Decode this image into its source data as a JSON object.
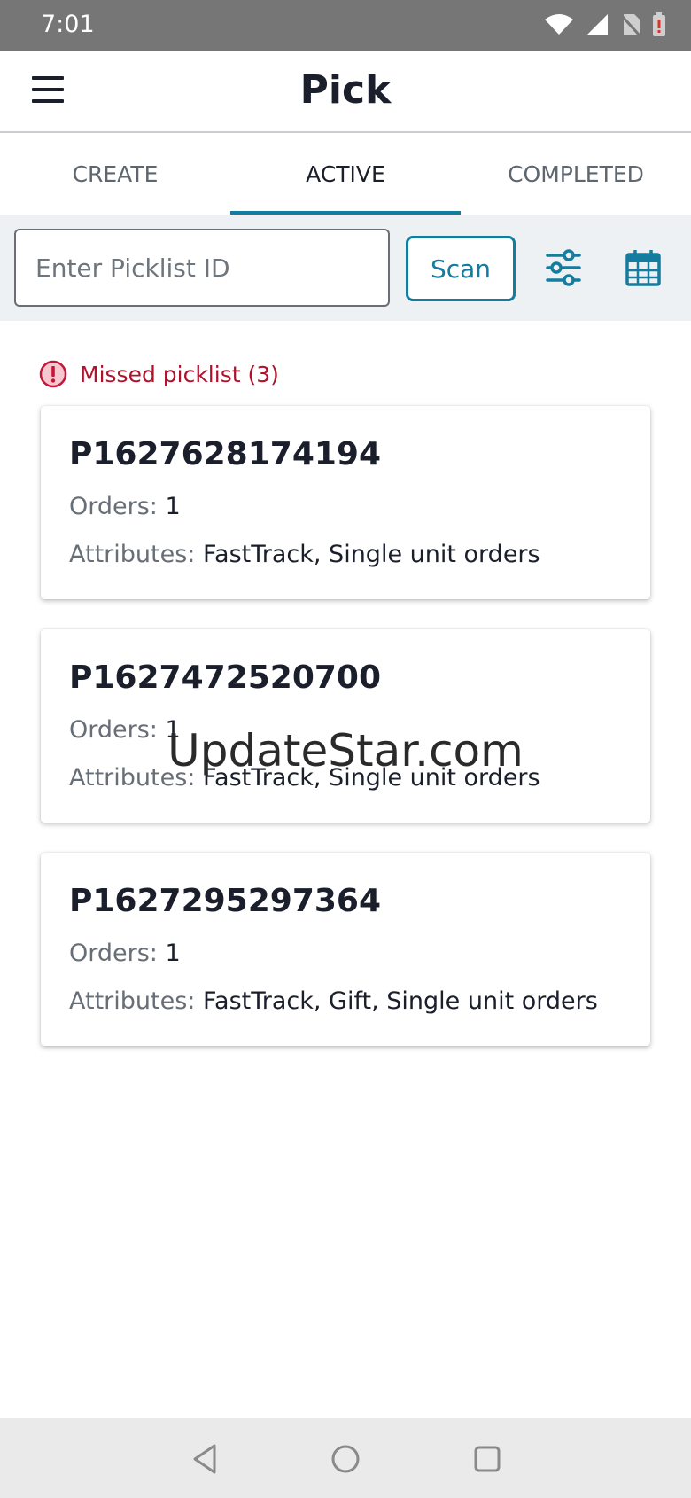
{
  "status_bar": {
    "time": "7:01",
    "icons": [
      "wifi-icon",
      "signal-icon",
      "no-sim-icon",
      "battery-low-icon"
    ]
  },
  "app_bar": {
    "title": "Pick",
    "menu_icon": "hamburger-menu-icon"
  },
  "tabs": [
    {
      "label": "CREATE",
      "active": false
    },
    {
      "label": "ACTIVE",
      "active": true
    },
    {
      "label": "COMPLETED",
      "active": false
    }
  ],
  "toolbar": {
    "search_placeholder": "Enter Picklist ID",
    "search_value": "",
    "scan_label": "Scan",
    "filter_icon": "filter-sliders-icon",
    "calendar_icon": "calendar-icon"
  },
  "missed": {
    "label": "Missed picklist (3)",
    "icon": "alert-icon",
    "color": "#b0122e"
  },
  "picklists": [
    {
      "id": "P1627628174194",
      "orders_label": "Orders:",
      "orders": "1",
      "attributes_label": "Attributes:",
      "attributes": "FastTrack, Single unit orders"
    },
    {
      "id": "P1627472520700",
      "orders_label": "Orders:",
      "orders": "1",
      "attributes_label": "Attributes:",
      "attributes": "FastTrack, Single unit orders"
    },
    {
      "id": "P1627295297364",
      "orders_label": "Orders:",
      "orders": "1",
      "attributes_label": "Attributes:",
      "attributes": "FastTrack, Gift, Single unit orders"
    }
  ],
  "watermark": "UpdateStar.com",
  "colors": {
    "accent": "#147c9e",
    "error": "#b0122e",
    "status_bar": "#767676"
  },
  "nav_bar": [
    "back-icon",
    "home-icon",
    "recents-icon"
  ]
}
